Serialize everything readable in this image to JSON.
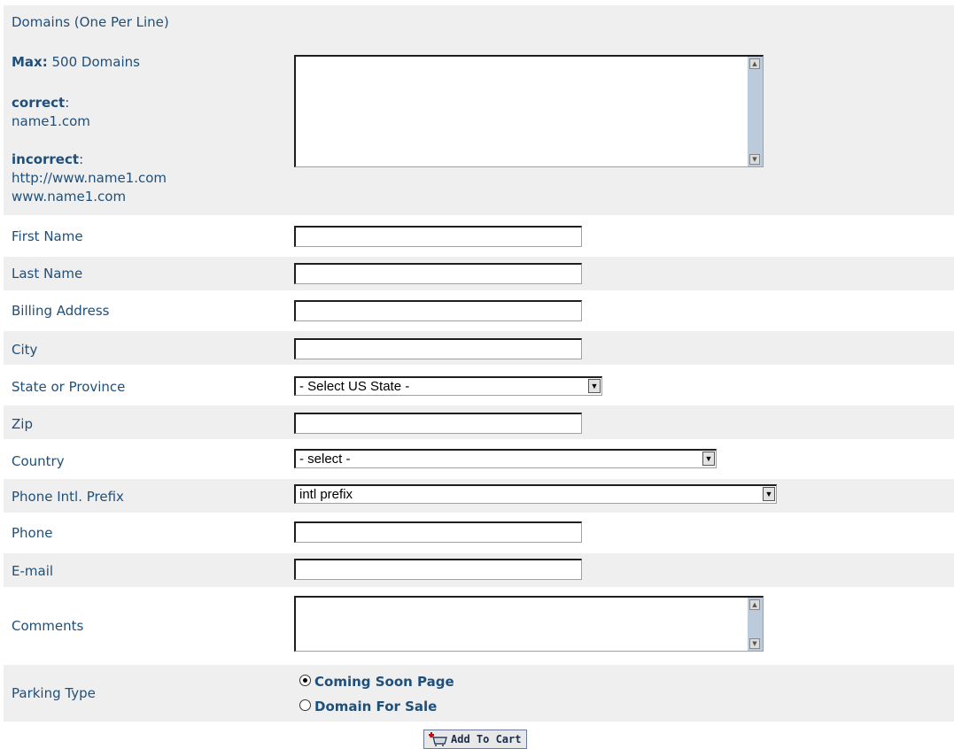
{
  "domains": {
    "label": "Domains (One Per Line)",
    "max_label": "Max:",
    "max_value": "500 Domains",
    "correct_label": "correct",
    "correct_example": "name1.com",
    "incorrect_label": "incorrect",
    "incorrect_example_1": "http://www.name1.com",
    "incorrect_example_2": "www.name1.com",
    "value": ""
  },
  "fields": {
    "first_name": {
      "label": "First Name",
      "value": ""
    },
    "last_name": {
      "label": "Last Name",
      "value": ""
    },
    "billing_address": {
      "label": "Billing Address",
      "value": ""
    },
    "city": {
      "label": "City",
      "value": ""
    },
    "state": {
      "label": "State or Province",
      "selected": "- Select US State -"
    },
    "zip": {
      "label": "Zip",
      "value": ""
    },
    "country": {
      "label": "Country",
      "selected": "- select -"
    },
    "phone_prefix": {
      "label": "Phone Intl. Prefix",
      "selected": "intl prefix"
    },
    "phone": {
      "label": "Phone",
      "value": ""
    },
    "email": {
      "label": "E-mail",
      "value": ""
    },
    "comments": {
      "label": "Comments",
      "value": ""
    }
  },
  "parking": {
    "label": "Parking Type",
    "options": [
      {
        "label": "Coming Soon Page",
        "selected": true
      },
      {
        "label": "Domain For Sale",
        "selected": false
      }
    ]
  },
  "submit": {
    "label": "Add To Cart",
    "icon": "cart-add-icon"
  },
  "colors": {
    "label_text": "#1f4f7a",
    "row_shade": "#efefef",
    "scrollbar": "#bccbdc"
  }
}
